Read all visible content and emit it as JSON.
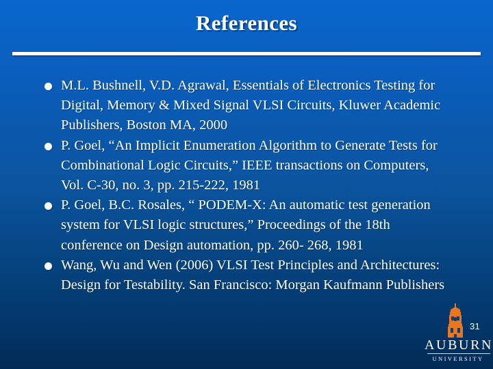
{
  "slide": {
    "title": "References",
    "page_number": "31",
    "background_top_color": "#0a66cc",
    "background_bottom_color": "#022a56",
    "text_color": "#ffffff"
  },
  "references": [
    {
      "bullet": "filled-circle-bullet",
      "text": "M.L. Bushnell, V.D. Agrawal, Essentials of Electronics Testing for Digital, Memory & Mixed Signal VLSI Circuits, Kluwer Academic Publishers, Boston MA, 2000"
    },
    {
      "bullet": "filled-circle-bullet",
      "text": "P. Goel, “An Implicit Enumeration Algorithm to Generate Tests for Combinational Logic Circuits,” IEEE transactions on Computers, Vol. C-30, no. 3, pp. 215-222, 1981"
    },
    {
      "bullet": "filled-circle-bullet",
      "text": "P. Goel, B.C. Rosales, “ PODEM-X: An automatic test generation system for VLSI logic structures,” Proceedings of the 18th conference on Design automation, pp. 260- 268, 1981"
    },
    {
      "bullet": "filled-circle-bullet",
      "text": "Wang, Wu and Wen (2006) VLSI Test Principles and Architectures: Design for Testability. San Francisco: Morgan Kaufmann Publishers"
    }
  ],
  "logo": {
    "icon_name": "auburn-tower-icon",
    "icon_color": "#e87722",
    "wordmark": "AUBURN",
    "subwordmark": "UNIVERSITY"
  }
}
